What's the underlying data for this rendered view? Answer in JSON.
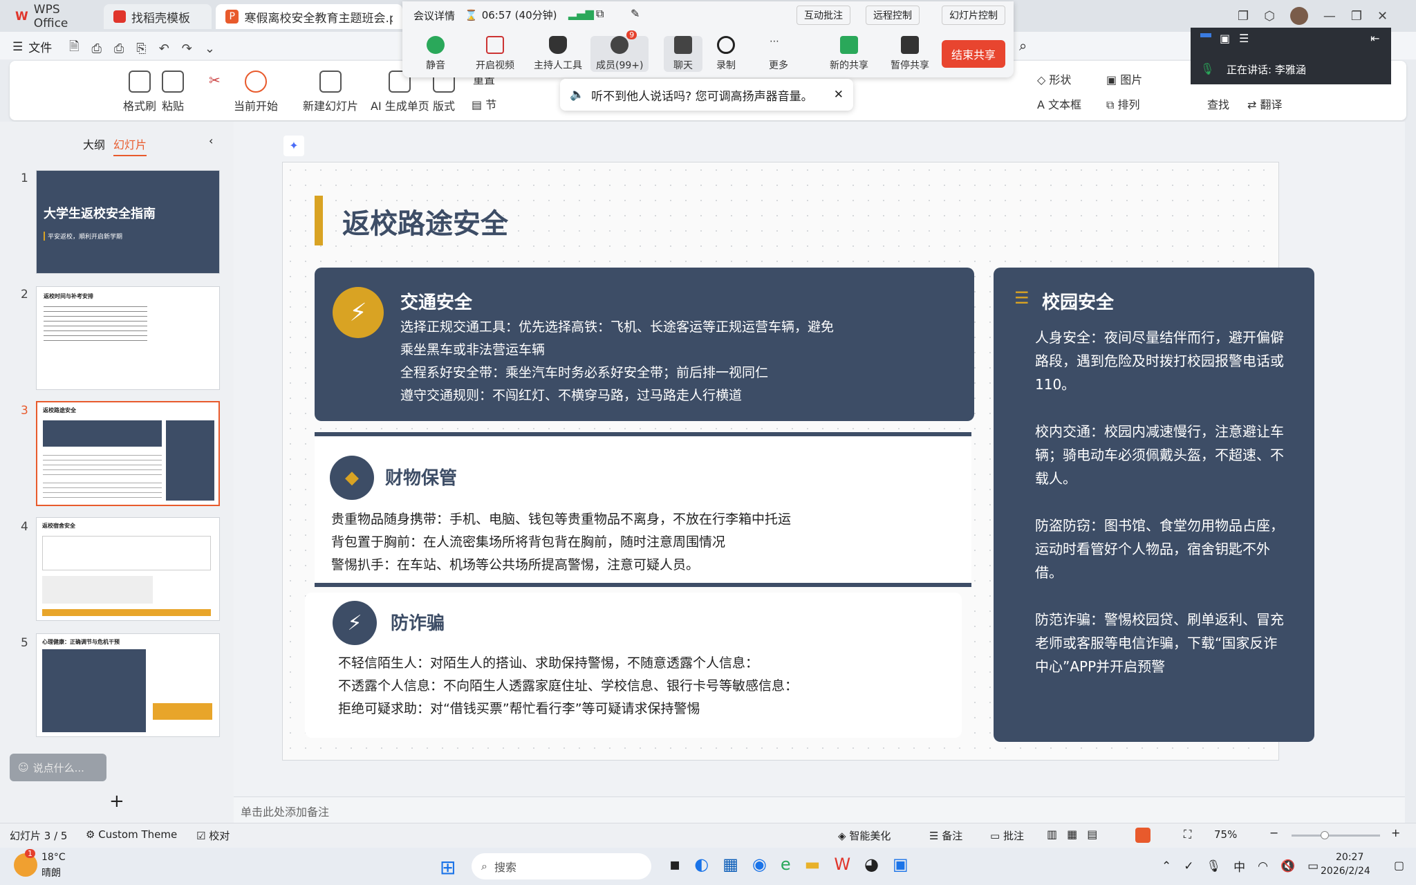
{
  "titlebar": {
    "tabs": [
      {
        "label": "WPS Office"
      },
      {
        "label": "找稻壳模板"
      },
      {
        "label": "寒假离校安全教育主题班会.p"
      }
    ]
  },
  "menu": {
    "file": "文件"
  },
  "ribbon": {
    "format_painter": "格式刷",
    "paste": "粘贴",
    "play_from_current": "当前开始",
    "new_slide": "新建幻灯片",
    "ai_single": "AI 生成单页",
    "layout": "版式",
    "section": "节",
    "reset": "重置",
    "shape": "形状",
    "picture": "图片",
    "textbox": "文本框",
    "arrange": "排列",
    "find": "查找",
    "translate": "翻译"
  },
  "meeting": {
    "details": "会议详情",
    "timer": "06:57 (40分钟)",
    "interact": "互动批注",
    "remote": "远程控制",
    "slide_control": "幻灯片控制",
    "mute": "静音",
    "video": "开启视频",
    "host_tools": "主持人工具",
    "members": "成员(99+)",
    "members_badge": "9",
    "chat": "聊天",
    "record": "录制",
    "more": "更多",
    "new_share": "新的共享",
    "pause_share": "暂停共享",
    "end_share": "结束共享",
    "toast": "听不到他人说话吗? 您可调高扬声器音量。"
  },
  "speaker": {
    "label": "正在讲话: 李雅涵"
  },
  "leftpanel": {
    "outline": "大纲",
    "slides": "幻灯片",
    "comment_placeholder": "说点什么...",
    "thumbs": [
      {
        "num": "1",
        "title": "大学生返校安全指南",
        "subtitle": "平安返校，順利开启新学期"
      },
      {
        "num": "2",
        "title": "返校时间与补考安排"
      },
      {
        "num": "3",
        "title": "返校路途安全"
      },
      {
        "num": "4",
        "title": "返校宿舍安全"
      },
      {
        "num": "5",
        "title": "心理健康：正确调节与危机干预"
      }
    ]
  },
  "slide": {
    "title": "返校路途安全",
    "traffic": {
      "title": "交通安全",
      "lines": [
        "选择正规交通工具：优先选择高铁：飞机、长途客运等正规运营车辆，避免",
        "乘坐黑车或非法营运车辆",
        "全程系好安全带：乘坐汽车时务必系好安全带；前后排一视同仁",
        "遵守交通规则：不闯红灯、不横穿马路，过马路走人行横道"
      ]
    },
    "property": {
      "title": "财物保管",
      "lines": [
        "贵重物品随身携带：手机、电脑、钱包等贵重物品不离身，不放在行李箱中托运",
        "背包置于胸前：在人流密集场所将背包背在胸前，随时注意周围情况",
        "警惕扒手：在车站、机场等公共场所提高警惕，注意可疑人员。"
      ]
    },
    "fraud": {
      "title": "防诈骗",
      "lines": [
        "不轻信陌生人：对陌生人的搭讪、求助保持警惕，不随意透露个人信息：",
        "不透露个人信息：不向陌生人透露家庭住址、学校信息、银行卡号等敏感信息：",
        "拒绝可疑求助：对“借钱买票”帮忙看行李”等可疑请求保持警惕"
      ]
    },
    "campus": {
      "title": "校园安全",
      "paras": [
        "人身安全：夜间尽量结伴而行，避开偏僻路段，遇到危险及时拨打校园报警电话或110。",
        "校内交通：校园内减速慢行，注意避让车辆；骑电动车必须佩戴头盔，不超速、不载人。",
        "防盗防窃：图书馆、食堂勿用物品占座，运动时看管好个人物品，宿舍钥匙不外借。",
        "防范诈骗：警惕校园贷、刷单返利、冒充老师或客服等电信诈骗，下载“国家反诈中心”APP并开启预警"
      ]
    }
  },
  "notes_placeholder": "单击此处添加备注",
  "status": {
    "slide_pos": "幻灯片 3 / 5",
    "theme": "Custom Theme",
    "proof": "校对",
    "beautify": "智能美化",
    "notes": "备注",
    "comment": "批注",
    "zoom": "75%"
  },
  "taskbar": {
    "temp": "18°C",
    "weather": "晴朗",
    "badge": "1",
    "search": "搜索",
    "ime": "中",
    "time": "20:27",
    "date": "2026/2/24"
  },
  "colors": {
    "navy": "#3d4d66",
    "gold": "#d9a323",
    "accent": "#e85a2c",
    "end_share": "#e8452f"
  }
}
